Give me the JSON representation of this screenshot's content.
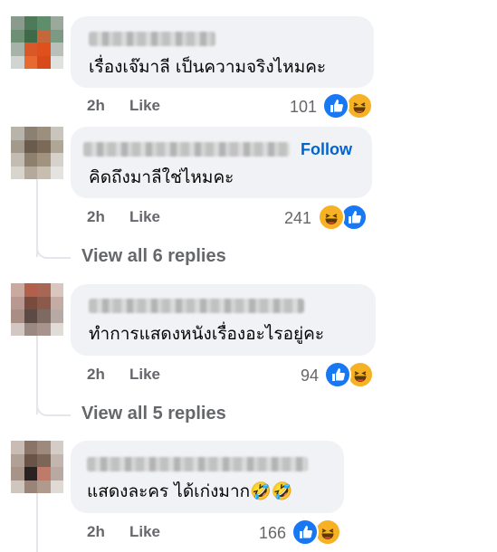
{
  "comments": [
    {
      "text": "เรื่องเจ๊มาลี เป็นความจริงไหมคะ",
      "time": "2h",
      "like_label": "Like",
      "count": "101",
      "reactions": [
        "like",
        "haha"
      ],
      "follow": ""
    },
    {
      "text": "คิดถึงมาลีใช่ไหมคะ",
      "time": "2h",
      "like_label": "Like",
      "count": "241",
      "reactions": [
        "haha",
        "like"
      ],
      "follow": "Follow"
    },
    {
      "text": "ทำการแสดงหนังเรื่องอะไรอยู่คะ",
      "time": "2h",
      "like_label": "Like",
      "count": "94",
      "reactions": [
        "like",
        "haha"
      ],
      "follow": ""
    },
    {
      "text": "แสดงละคร ได้เก่งมาก🤣🤣",
      "time": "2h",
      "like_label": "Like",
      "count": "166",
      "reactions": [
        "like",
        "haha"
      ],
      "follow": ""
    }
  ],
  "replies": [
    {
      "label": "View all 6 replies"
    },
    {
      "label": "View all 5 replies"
    }
  ],
  "colors": {
    "like": "#1877f2",
    "haha": "#f7b125",
    "link": "#0064d1",
    "meta": "#65676b",
    "bubble": "#f0f2f5"
  },
  "icons": {
    "like": "thumbs-up-icon",
    "haha": "laughing-face-icon"
  }
}
